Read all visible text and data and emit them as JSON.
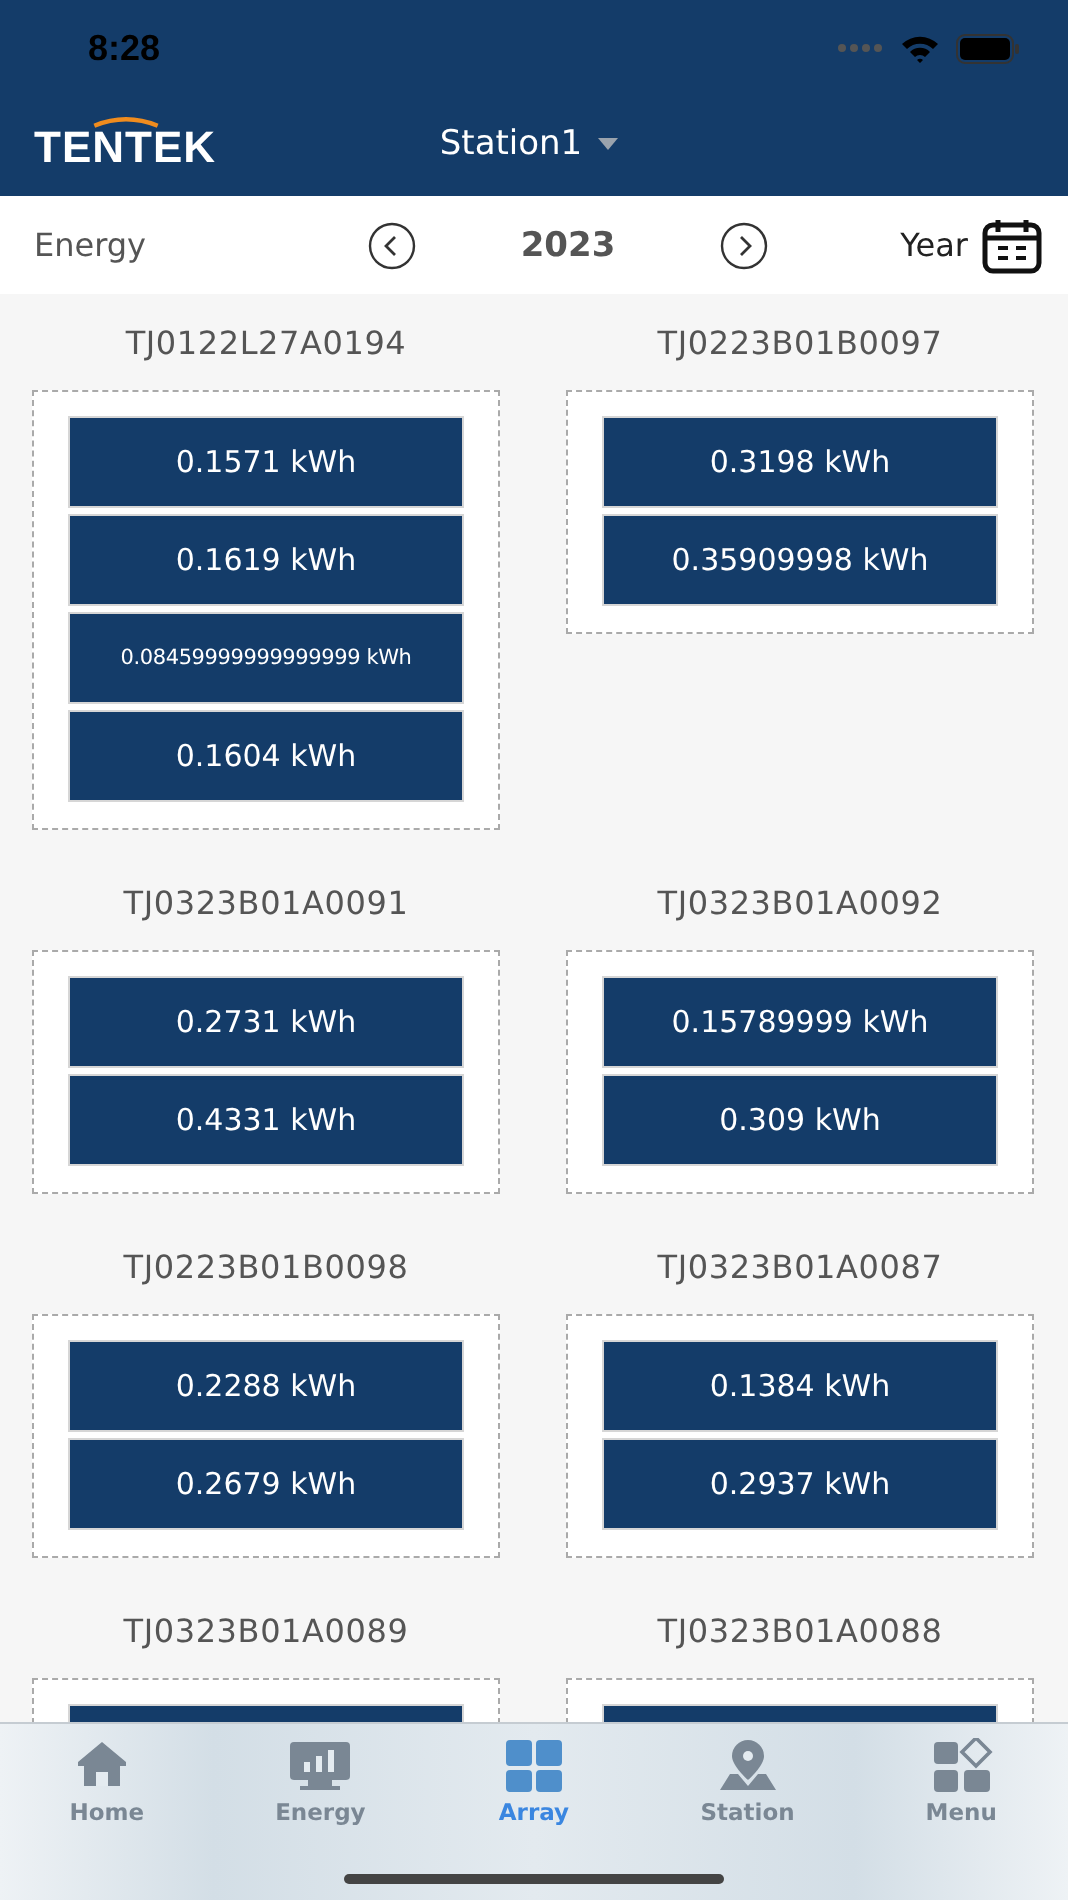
{
  "status_bar": {
    "time": "8:28"
  },
  "header": {
    "logo": "TENTEK",
    "station": "Station1"
  },
  "toolbar": {
    "label": "Energy",
    "year": "2023",
    "period": "Year"
  },
  "groups": [
    {
      "title": "TJ0122L27A0194",
      "readings": [
        "0.1571 kWh",
        "0.1619 kWh",
        "0.08459999999999999 kWh",
        "0.1604 kWh"
      ]
    },
    {
      "title": "TJ0223B01B0097",
      "readings": [
        "0.3198 kWh",
        "0.35909998 kWh"
      ]
    },
    {
      "title": "TJ0323B01A0091",
      "readings": [
        "0.2731 kWh",
        "0.4331 kWh"
      ]
    },
    {
      "title": "TJ0323B01A0092",
      "readings": [
        "0.15789999 kWh",
        "0.309 kWh"
      ]
    },
    {
      "title": "TJ0223B01B0098",
      "readings": [
        "0.2288 kWh",
        "0.2679 kWh"
      ]
    },
    {
      "title": "TJ0323B01A0087",
      "readings": [
        "0.1384 kWh",
        "0.2937 kWh"
      ]
    },
    {
      "title": "TJ0323B01A0089",
      "cut_off": true
    },
    {
      "title": "TJ0323B01A0088",
      "cut_off": true
    }
  ],
  "tabs": [
    {
      "kind": "home",
      "label": "Home",
      "selected": false
    },
    {
      "kind": "energy",
      "label": "Energy",
      "selected": false
    },
    {
      "kind": "array",
      "label": "Array",
      "selected": true
    },
    {
      "kind": "station",
      "label": "Station",
      "selected": false
    },
    {
      "kind": "menu",
      "label": "Menu",
      "selected": false
    }
  ]
}
